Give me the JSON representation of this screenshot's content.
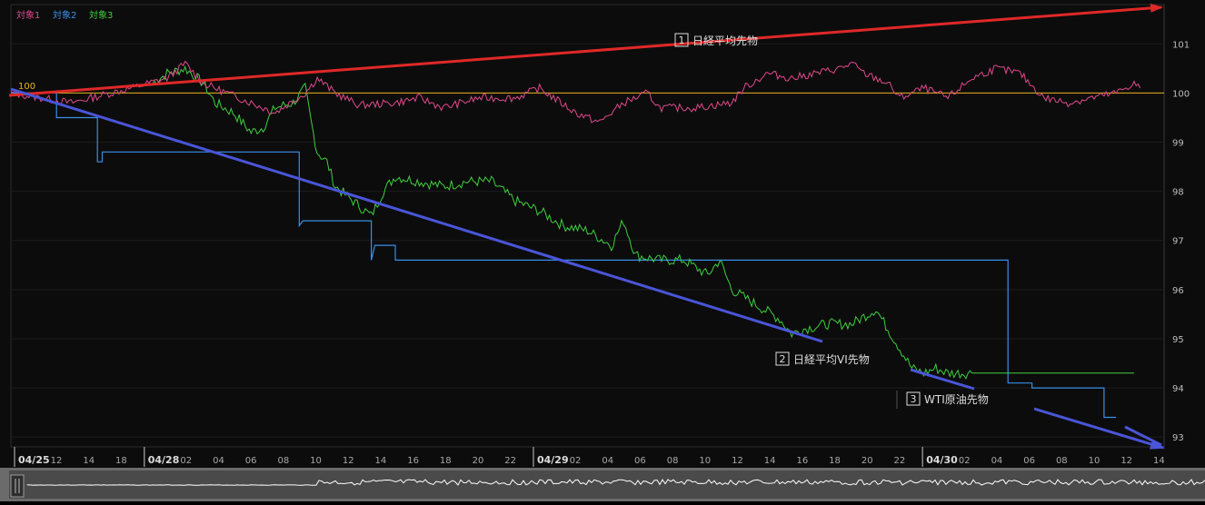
{
  "legend": [
    {
      "label": "対象1",
      "color": "#e0488e"
    },
    {
      "label": "対象2",
      "color": "#3a8ee6"
    },
    {
      "label": "対象3",
      "color": "#3ecf3e"
    }
  ],
  "baseline_label": "100",
  "annotations": [
    {
      "num": "1",
      "text": "日経平均先物"
    },
    {
      "num": "2",
      "text": "日経平均VI先物"
    },
    {
      "num": "3",
      "text": "WTI原油先物"
    }
  ],
  "x_ticks": [
    "04/25",
    "12",
    "14",
    "18",
    "04/28",
    "02",
    "04",
    "06",
    "08",
    "10",
    "12",
    "14",
    "16",
    "18",
    "20",
    "22",
    "04/29",
    "02",
    "04",
    "06",
    "08",
    "10",
    "12",
    "14",
    "16",
    "18",
    "20",
    "22",
    "04/30",
    "02",
    "04",
    "06",
    "08",
    "10",
    "12",
    "14"
  ],
  "colors": {
    "series1": "#e0488e",
    "series2": "#3a8ee6",
    "series3": "#3ecf3e",
    "baseline": "#e8b21a",
    "trend_up": "#e02828",
    "trend_down": "#4a55d8"
  },
  "chart_data": {
    "type": "line",
    "ylim": [
      92.8,
      101.8
    ],
    "y_ticks": [
      93,
      94,
      95,
      96,
      97,
      98,
      99,
      100,
      101
    ],
    "baseline": 100,
    "series": [
      {
        "name": "対象1",
        "points": [
          [
            0,
            100.0
          ],
          [
            5,
            99.8
          ],
          [
            10,
            100.1
          ],
          [
            13,
            100.3
          ],
          [
            14,
            100.5
          ],
          [
            14.5,
            100.6
          ],
          [
            16,
            100.2
          ],
          [
            19,
            99.9
          ],
          [
            22,
            99.6
          ],
          [
            24.5,
            100.0
          ],
          [
            25.5,
            100.3
          ],
          [
            27,
            100.0
          ],
          [
            29,
            99.75
          ],
          [
            32,
            99.8
          ],
          [
            34,
            99.9
          ],
          [
            36,
            99.7
          ],
          [
            39,
            99.9
          ],
          [
            42,
            99.9
          ],
          [
            44,
            100.1
          ],
          [
            47,
            99.6
          ],
          [
            49,
            99.4
          ],
          [
            51,
            99.8
          ],
          [
            53,
            100.0
          ],
          [
            54,
            99.7
          ],
          [
            57,
            99.7
          ],
          [
            60,
            99.8
          ],
          [
            61,
            100.1
          ],
          [
            63,
            100.4
          ],
          [
            65,
            100.3
          ],
          [
            67,
            100.4
          ],
          [
            69,
            100.5
          ],
          [
            70,
            100.6
          ],
          [
            71,
            100.4
          ],
          [
            73,
            100.2
          ],
          [
            74,
            99.9
          ],
          [
            76,
            100.1
          ],
          [
            78,
            99.9
          ],
          [
            80,
            100.3
          ],
          [
            82,
            100.5
          ],
          [
            84,
            100.4
          ],
          [
            86,
            99.9
          ],
          [
            88,
            99.8
          ],
          [
            90,
            99.9
          ],
          [
            92,
            100.0
          ],
          [
            93.5,
            100.2
          ],
          [
            94,
            100.1
          ]
        ]
      },
      {
        "name": "対象2",
        "points": [
          [
            0,
            100.0
          ],
          [
            3.8,
            100.0
          ],
          [
            3.8,
            99.5
          ],
          [
            7.2,
            99.5
          ],
          [
            7.2,
            98.6
          ],
          [
            7.6,
            98.6
          ],
          [
            7.6,
            98.8
          ],
          [
            24,
            98.8
          ],
          [
            24,
            97.3
          ],
          [
            24.3,
            97.4
          ],
          [
            30,
            97.4
          ],
          [
            30,
            96.6
          ],
          [
            30.3,
            96.9
          ],
          [
            32,
            96.9
          ],
          [
            32,
            96.6
          ],
          [
            83,
            96.6
          ],
          [
            83,
            94.1
          ],
          [
            85,
            94.1
          ],
          [
            85,
            94.0
          ],
          [
            91,
            94.0
          ],
          [
            91,
            93.4
          ],
          [
            92,
            93.4
          ]
        ]
      },
      {
        "name": "対象3",
        "points": [
          [
            11.8,
            100.2
          ],
          [
            13,
            100.4
          ],
          [
            14.5,
            100.5
          ],
          [
            16,
            100.2
          ],
          [
            17,
            99.8
          ],
          [
            18.5,
            99.6
          ],
          [
            20,
            99.2
          ],
          [
            21,
            99.3
          ],
          [
            22,
            99.7
          ],
          [
            23.5,
            99.8
          ],
          [
            24.5,
            100.1
          ],
          [
            25,
            99.4
          ],
          [
            25.5,
            98.8
          ],
          [
            26.3,
            98.6
          ],
          [
            27,
            98.1
          ],
          [
            28,
            97.9
          ],
          [
            29,
            97.7
          ],
          [
            30,
            97.5
          ],
          [
            31,
            98.0
          ],
          [
            32,
            98.3
          ],
          [
            34,
            98.2
          ],
          [
            36,
            98.1
          ],
          [
            38,
            98.2
          ],
          [
            40,
            98.2
          ],
          [
            41,
            98.0
          ],
          [
            42,
            97.8
          ],
          [
            44,
            97.6
          ],
          [
            46,
            97.3
          ],
          [
            48,
            97.2
          ],
          [
            50,
            96.9
          ],
          [
            51,
            97.4
          ],
          [
            52,
            96.7
          ],
          [
            54,
            96.6
          ],
          [
            56,
            96.6
          ],
          [
            58,
            96.3
          ],
          [
            59,
            96.6
          ],
          [
            60,
            96.0
          ],
          [
            62,
            95.7
          ],
          [
            64,
            95.4
          ],
          [
            65,
            95.1
          ],
          [
            66,
            95.2
          ],
          [
            68,
            95.3
          ],
          [
            70,
            95.3
          ],
          [
            72,
            95.6
          ],
          [
            73,
            95.2
          ],
          [
            74,
            94.8
          ],
          [
            75,
            94.4
          ],
          [
            76,
            94.3
          ],
          [
            77,
            94.4
          ],
          [
            78,
            94.3
          ],
          [
            80,
            94.3
          ],
          [
            93.5,
            94.3
          ]
        ]
      }
    ]
  }
}
